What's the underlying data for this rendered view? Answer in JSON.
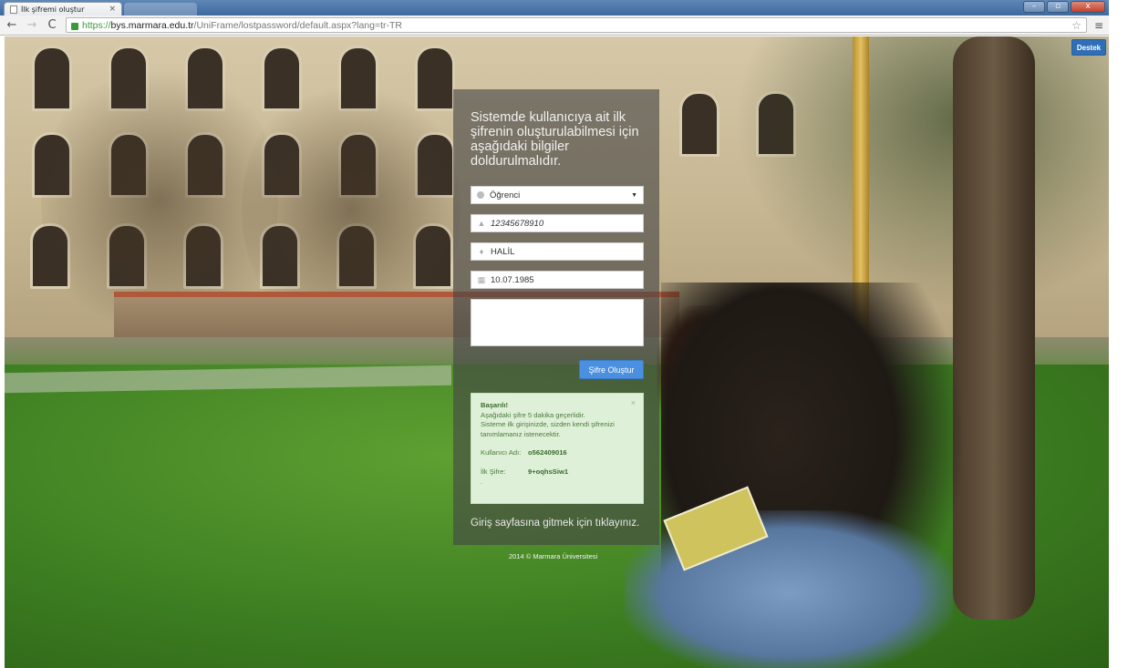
{
  "browser": {
    "tab_title": "İlk şifremi oluştur",
    "tab_close": "×",
    "window_buttons": [
      "–",
      "▫",
      "x"
    ],
    "url_scheme": "https://",
    "url_host": "bys.marmara.edu.tr",
    "url_path": "/UniFrame/lostpassword/default.aspx?lang=tr-TR",
    "icons": [
      "back-icon",
      "forward-icon",
      "reload-icon",
      "lock-icon",
      "star-icon",
      "menu-icon"
    ]
  },
  "page": {
    "support_button": "Destek",
    "heading": "Sistemde kullanıcıya ait ilk şifrenin oluşturulabilmesi için aşağıdaki bilgiler doldurulmalıdır.",
    "form": {
      "user_type": "Öğrenci",
      "id_number": "12345678910",
      "name": "HALİL",
      "birth_date": "10.07.1985",
      "submit_label": "Şifre Oluştur"
    },
    "alert": {
      "title": "Başarılı!",
      "line1": "Aşağıdaki şifre 5 dakika geçerlidir.",
      "line2": "Sisteme ilk girişinizde, sizden kendi şifrenizi tanımlamanız istenecektir.",
      "username_label": "Kullanıcı Adı:",
      "username_value": "o562409016",
      "password_label": "İlk Şifre:",
      "password_value": "9+oqhsSiw1",
      "trailing": ".",
      "close": "×"
    },
    "login_link": "Giriş sayfasına gitmek için tıklayınız.",
    "footer": "2014 © Marmara Üniversitesi"
  },
  "colors": {
    "primary_button": "#4a8fe0",
    "support_button": "#2f6fb7",
    "alert_bg": "#dff0d8",
    "alert_text": "#4b7a3c",
    "panel_overlay": "rgba(70,70,70,0.62)"
  }
}
